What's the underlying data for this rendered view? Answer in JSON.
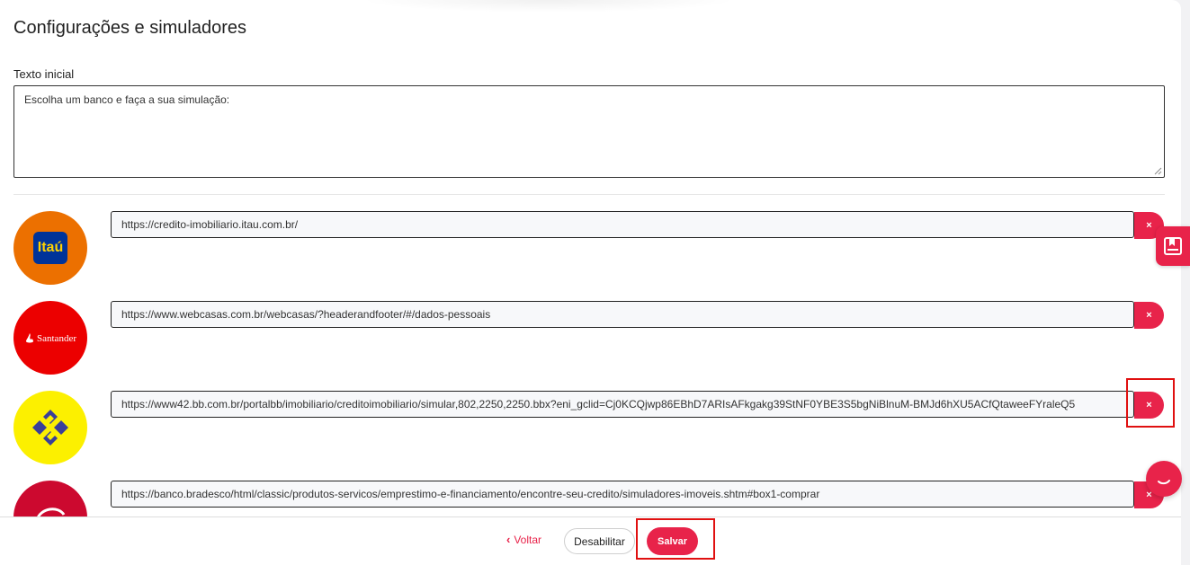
{
  "page": {
    "title": "Configurações e simuladores",
    "initial_text_label": "Texto inicial",
    "initial_text_value": "Escolha um banco e faça a sua simulação:"
  },
  "simulators": [
    {
      "bank_icon": "itau-logo",
      "logo_text": "Itaú",
      "url": "https://credito-imobiliario.itau.com.br/"
    },
    {
      "bank_icon": "santander-logo",
      "logo_text": "Santander",
      "url": "https://www.webcasas.com.br/webcasas/?headerandfooter/#/dados-pessoais"
    },
    {
      "bank_icon": "banco-do-brasil-logo",
      "logo_text": "",
      "url": "https://www42.bb.com.br/portalbb/imobiliario/creditoimobiliario/simular,802,2250,2250.bbx?eni_gclid=Cj0KCQjwp86EBhD7ARIsAFkgakg39StNF0YBE3S5bgNiBlnuM-BMJd6hXU5ACfQtaweeFYraleQ5"
    },
    {
      "bank_icon": "bradesco-logo",
      "logo_text": "",
      "url": "https://banco.bradesco/html/classic/produtos-servicos/emprestimo-e-financiamento/encontre-seu-credito/simuladores-imoveis.shtm#box1-comprar"
    }
  ],
  "delete_icon": "×",
  "footer": {
    "back_label": "Voltar",
    "disable_label": "Desabilitar",
    "save_label": "Salvar"
  },
  "colors": {
    "accent": "#e8234a",
    "itau_orange": "#ec7000",
    "itau_blue": "#003399",
    "santander_red": "#ec0000",
    "bb_yellow": "#fcf000",
    "bb_blue": "#3a3f99",
    "bradesco_red": "#cc092f",
    "highlight": "#e01010"
  }
}
